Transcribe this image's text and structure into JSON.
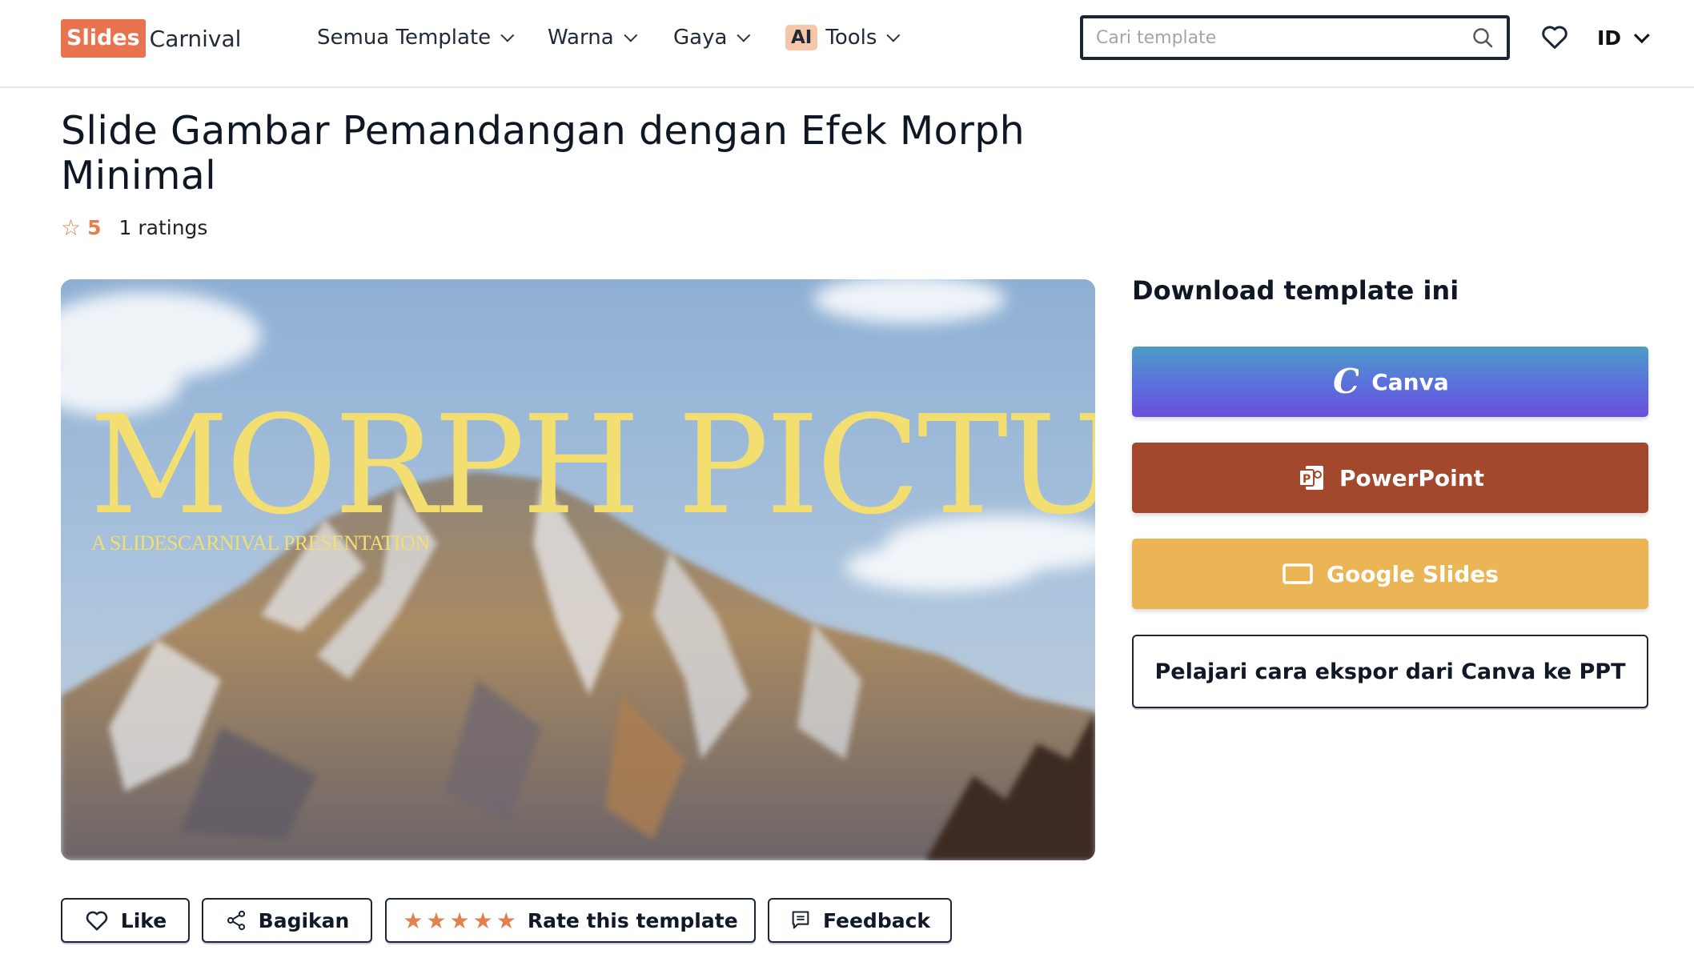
{
  "header": {
    "logo_box": "Slides",
    "logo_text": "Carnival",
    "nav": [
      {
        "label": "Semua Template"
      },
      {
        "label": "Warna"
      },
      {
        "label": "Gaya"
      },
      {
        "label": "Tools",
        "badge": "AI"
      }
    ],
    "search": {
      "placeholder": "Cari template",
      "value": ""
    },
    "language": "ID"
  },
  "page": {
    "title": "Slide Gambar Pemandangan dengan Efek Morph Minimal",
    "rating_score": "5",
    "rating_count": "1 ratings"
  },
  "preview": {
    "headline": "MORPH PICTURE",
    "subtitle": "A SLIDESCARNIVAL PRESENTATION"
  },
  "actions": {
    "like": "Like",
    "share": "Bagikan",
    "rate": "Rate this template",
    "rate_stars": "★★★★★",
    "feedback": "Feedback"
  },
  "download": {
    "title": "Download template ini",
    "canva": "Canva",
    "powerpoint": "PowerPoint",
    "google_slides": "Google Slides",
    "learn": "Pelajari cara ekspor dari Canva ke PPT"
  },
  "colors": {
    "brand": "#e8734f",
    "canva_gradient": [
      "#4e9cc8",
      "#6a4fdd"
    ],
    "powerpoint": "#a3472d",
    "google_slides": "#ebb454",
    "headline": "#f3de72"
  }
}
